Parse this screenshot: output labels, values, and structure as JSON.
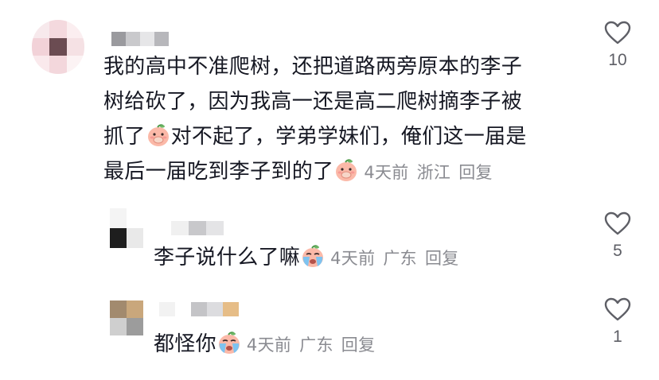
{
  "comments": [
    {
      "text_lines": [
        "我的高中不准爬树，还把道路两旁原本的李子",
        "树给砍了，因为我高一还是高二爬树摘李子被"
      ],
      "line3_before_emoji": "抓了",
      "line3_after_emoji": "对不起了，学弟学妹们，俺们这一届是",
      "line4_before_emoji": "最后一届吃到李子到的了",
      "emoji_1": "peach-cover-mouth-emoji",
      "emoji_2": "peach-cover-mouth-emoji",
      "time": "4天前",
      "location": "浙江",
      "reply_label": "回复",
      "like_count": "10"
    },
    {
      "text": "李子说什么了嘛",
      "emoji": "peach-crying-emoji",
      "time": "4天前",
      "location": "广东",
      "reply_label": "回复",
      "like_count": "5"
    },
    {
      "text": "都怪你",
      "emoji": "peach-crying-emoji",
      "time": "4天前",
      "location": "广东",
      "reply_label": "回复",
      "like_count": "1"
    }
  ],
  "colors": {
    "text": "#161823",
    "meta": "#8a8b91",
    "like_icon": "#5e5f66"
  }
}
